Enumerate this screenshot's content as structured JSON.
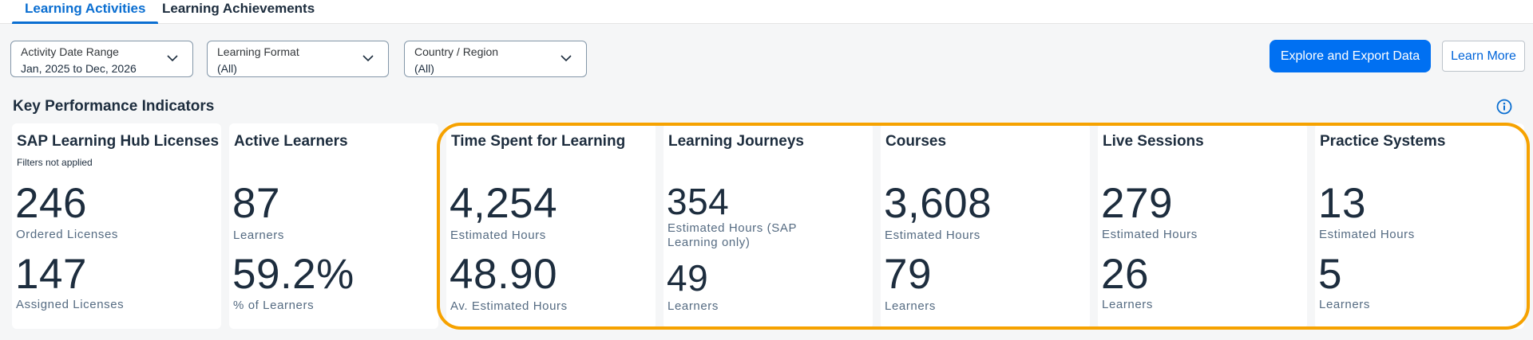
{
  "tabs": [
    {
      "label": "Learning Activities",
      "active": true
    },
    {
      "label": "Learning Achievements",
      "active": false
    }
  ],
  "filters": [
    {
      "label": "Activity Date Range",
      "value": "Jan, 2025 to Dec, 2026"
    },
    {
      "label": "Learning Format",
      "value": "(All)"
    },
    {
      "label": "Country / Region",
      "value": "(All)"
    }
  ],
  "actions": {
    "primary_label": "Explore and Export Data",
    "secondary_label": "Learn More"
  },
  "kpi_section": {
    "title": "Key Performance Indicators",
    "info_icon": "info-icon"
  },
  "cards": [
    {
      "title": "SAP Learning Hub Licenses",
      "note": "Filters not applied",
      "metric1": {
        "value": "246",
        "label": "Ordered Licenses"
      },
      "metric2": {
        "value": "147",
        "label": "Assigned Licenses"
      }
    },
    {
      "title": "Active Learners",
      "metric1": {
        "value": "87",
        "label": "Learners"
      },
      "metric2": {
        "value": "59.2%",
        "label": "% of Learners"
      }
    },
    {
      "title": "Time Spent for Learning",
      "metric1": {
        "value": "4,254",
        "label": "Estimated Hours"
      },
      "metric2": {
        "value": "48.90",
        "label": "Av. Estimated Hours"
      }
    },
    {
      "title": "Learning Journeys",
      "metric1": {
        "value": "354",
        "label": "Estimated Hours (SAP\nLearning only)"
      },
      "metric2": {
        "value": "49",
        "label": "Learners"
      }
    },
    {
      "title": "Courses",
      "metric1": {
        "value": "3,608",
        "label": "Estimated Hours"
      },
      "metric2": {
        "value": "79",
        "label": "Learners"
      }
    },
    {
      "title": "Live Sessions",
      "metric1": {
        "value": "279",
        "label": "Estimated Hours"
      },
      "metric2": {
        "value": "26",
        "label": "Learners"
      }
    },
    {
      "title": "Practice Systems",
      "metric1": {
        "value": "13",
        "label": "Estimated Hours"
      },
      "metric2": {
        "value": "5",
        "label": "Learners"
      }
    }
  ],
  "colors": {
    "accent": "#0070f2",
    "active_tab": "#0a6ed1",
    "highlight_border": "#f6a200",
    "text": "#1d2d3e",
    "subtext": "#556b82",
    "background": "#f5f6f7"
  }
}
